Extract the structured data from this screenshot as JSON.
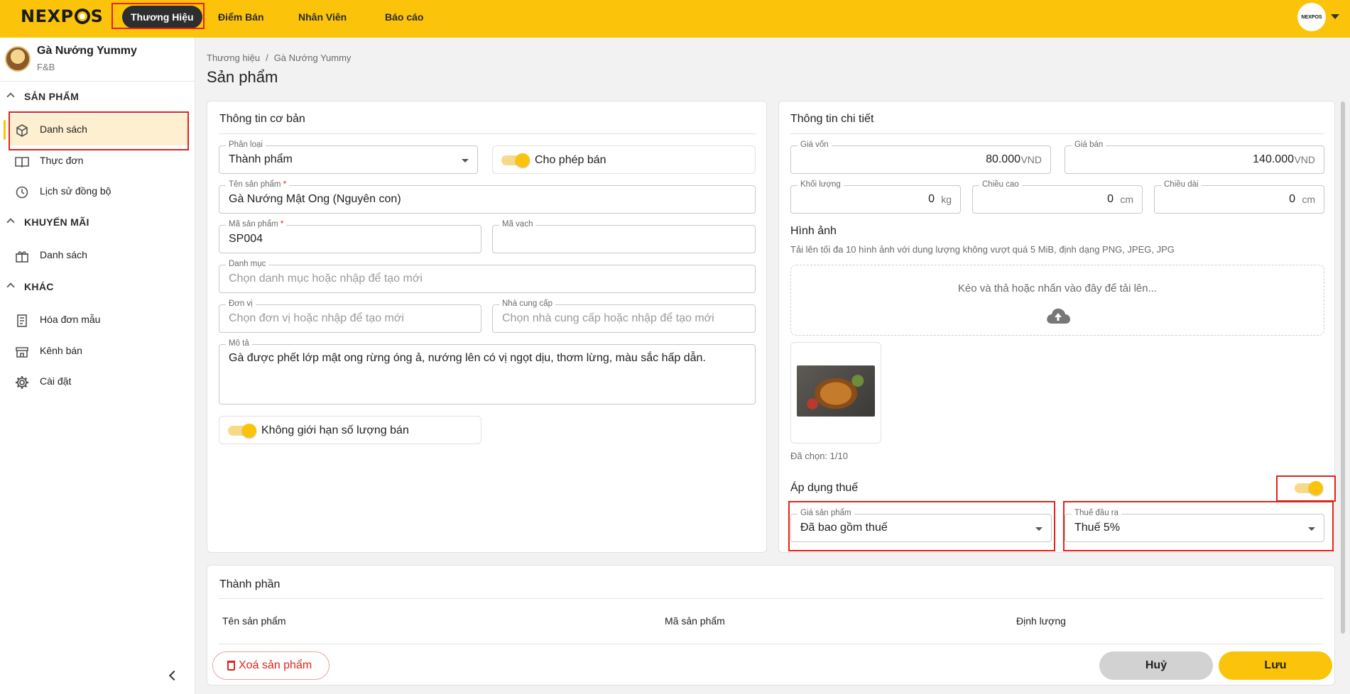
{
  "topbar": {
    "logo": "NEXPOS",
    "nav": [
      {
        "label": "Thương Hiệu",
        "active": true
      },
      {
        "label": "Điểm Bán"
      },
      {
        "label": "Nhân Viên"
      },
      {
        "label": "Báo cáo"
      }
    ],
    "avatar_text": "NEXPOS"
  },
  "sidebar": {
    "brand_name": "Gà Nướng Yummy",
    "brand_type": "F&B",
    "sections": [
      {
        "title": "SẢN PHẨM",
        "items": [
          {
            "label": "Danh sách",
            "icon": "box-icon",
            "active": true
          },
          {
            "label": "Thực đơn",
            "icon": "menu-book-icon"
          },
          {
            "label": "Lịch sử đồng bộ",
            "icon": "history-icon"
          }
        ]
      },
      {
        "title": "KHUYẾN MÃI",
        "items": [
          {
            "label": "Danh sách",
            "icon": "gift-icon"
          }
        ]
      },
      {
        "title": "KHÁC",
        "items": [
          {
            "label": "Hóa đơn mẫu",
            "icon": "receipt-icon"
          },
          {
            "label": "Kênh bán",
            "icon": "store-icon"
          },
          {
            "label": "Cài đặt",
            "icon": "gear-icon"
          }
        ]
      }
    ]
  },
  "breadcrumb": {
    "items": [
      "Thương hiệu",
      "Gà Nướng Yummy"
    ],
    "separator": "/"
  },
  "page_title": "Sản phẩm",
  "basic": {
    "title": "Thông tin cơ bản",
    "category_type": {
      "label": "Phân loại",
      "value": "Thành phẩm"
    },
    "allow_sale": {
      "label": "Cho phép bán",
      "on": true
    },
    "product_name": {
      "label": "Tên sản phẩm",
      "required": "*",
      "value": "Gà Nướng Mật Ong (Nguyên con)"
    },
    "product_code": {
      "label": "Mã sản phẩm",
      "required": "*",
      "value": "SP004"
    },
    "barcode": {
      "label": "Mã vạch",
      "value": ""
    },
    "category": {
      "label": "Danh mục",
      "placeholder": "Chọn danh mục hoặc nhập để tạo mới"
    },
    "unit": {
      "label": "Đơn vị",
      "placeholder": "Chọn đơn vị hoặc nhập để tạo mới"
    },
    "supplier": {
      "label": "Nhà cung cấp",
      "placeholder": "Chọn nhà cung cấp hoặc nhập để tạo mới"
    },
    "description": {
      "label": "Mô tả",
      "value": "Gà được phết lớp mật ong rừng óng ả, nướng lên có vị ngọt dịu, thơm lừng, màu sắc hấp dẫn."
    },
    "unlimited_qty": {
      "label": "Không giới hạn số lượng bán",
      "on": true
    }
  },
  "detail": {
    "title": "Thông tin chi tiết",
    "cost_price": {
      "label": "Giá vốn",
      "value": "80.000",
      "unit": "VND"
    },
    "sell_price": {
      "label": "Giá bán",
      "value": "140.000",
      "unit": "VND"
    },
    "weight": {
      "label": "Khối lượng",
      "value": "0",
      "unit": "kg"
    },
    "height": {
      "label": "Chiều cao",
      "value": "0",
      "unit": "cm"
    },
    "length": {
      "label": "Chiều dài",
      "value": "0",
      "unit": "cm"
    },
    "images_title": "Hình ảnh",
    "images_hint": "Tải lên tối đa 10 hình ảnh với dung lượng không vượt quá 5 MiB, định dạng PNG, JPEG, JPG",
    "dropzone_text": "Kéo và thả hoặc nhấn vào đây để tải lên...",
    "selected_count": "Đã chọn: 1/10",
    "tax_title": "Áp dụng thuế",
    "tax_on": true,
    "price_mode": {
      "label": "Giá sản phẩm",
      "value": "Đã bao gồm thuế"
    },
    "output_tax": {
      "label": "Thuế đầu ra",
      "value": "Thuế 5%"
    }
  },
  "components": {
    "title": "Thành phần",
    "columns": [
      "Tên sản phẩm",
      "Mã sản phẩm",
      "Định lượng"
    ]
  },
  "actions": {
    "delete": "Xoá sản phẩm",
    "cancel": "Huỷ",
    "save": "Lưu"
  },
  "colors": {
    "accent": "#fbc30a",
    "danger": "#e0241b"
  }
}
